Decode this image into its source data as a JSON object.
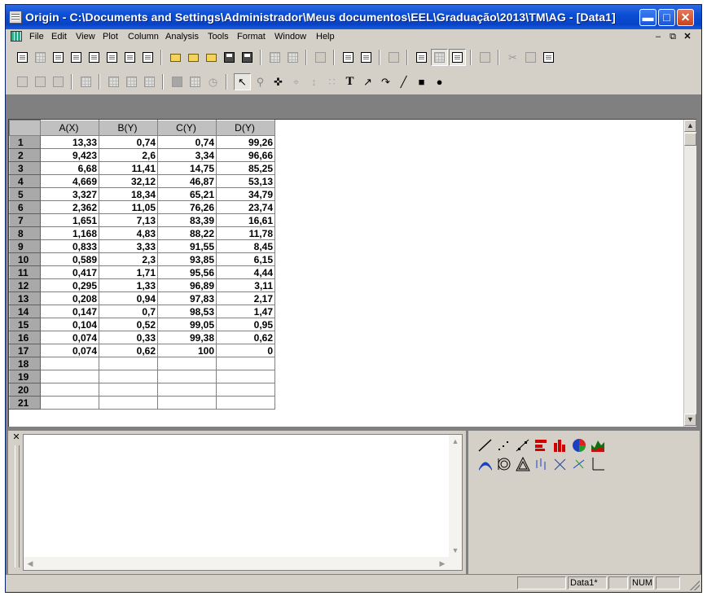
{
  "window": {
    "title": "Origin - C:\\Documents and Settings\\Administrador\\Meus documentos\\EEL\\Graduação\\2013\\TM\\AG - [Data1]",
    "caption_buttons": [
      "minimize-icon",
      "maximize-icon",
      "close-icon"
    ]
  },
  "menubar": {
    "items": [
      "File",
      "Edit",
      "View",
      "Plot",
      "Column",
      "Analysis",
      "Tools",
      "Format",
      "Window",
      "Help"
    ],
    "mdi_controls": [
      "minimize-icon",
      "restore-icon",
      "close-icon"
    ]
  },
  "toolbar_standard": {
    "icons": [
      "new-project-icon",
      "new-worksheet-icon",
      "new-excel-icon",
      "new-graph-icon",
      "new-matrix-icon",
      "new-function-icon",
      "new-layout-icon",
      "new-notes-icon",
      "open-icon",
      "open-template-icon",
      "open-excel-icon",
      "save-project-icon",
      "save-template-icon",
      "import-ascii-icon",
      "import-multiple-ascii-icon",
      "print-icon",
      "refresh-icon",
      "duplicate-icon",
      "project-explorer-icon",
      "results-log-icon",
      "script-window-icon",
      "code-builder-icon",
      "add-column-icon",
      "cut-icon",
      "copy-icon",
      "paste-icon"
    ]
  },
  "toolbar_tools": {
    "icons": [
      "zoom-in-icon",
      "zoom-out-icon",
      "whole-page-icon",
      "rescale-icon",
      "merge-icon",
      "layer-icon",
      "arrange-icon",
      "color-icon",
      "data-display-icon",
      "clock-icon",
      "pointer-icon",
      "zoom-icon",
      "screen-reader-icon",
      "data-reader-icon",
      "data-selector-icon",
      "draw-data-icon",
      "text-tool-icon",
      "arrow-tool-icon",
      "curved-arrow-icon",
      "line-tool-icon",
      "rectangle-tool-icon",
      "circle-tool-icon"
    ],
    "text_tool_label": "T"
  },
  "worksheet": {
    "name": "Data1",
    "columns": [
      "A(X)",
      "B(Y)",
      "C(Y)",
      "D(Y)"
    ],
    "rows": [
      [
        "1",
        "13,33",
        "0,74",
        "0,74",
        "99,26"
      ],
      [
        "2",
        "9,423",
        "2,6",
        "3,34",
        "96,66"
      ],
      [
        "3",
        "6,68",
        "11,41",
        "14,75",
        "85,25"
      ],
      [
        "4",
        "4,669",
        "32,12",
        "46,87",
        "53,13"
      ],
      [
        "5",
        "3,327",
        "18,34",
        "65,21",
        "34,79"
      ],
      [
        "6",
        "2,362",
        "11,05",
        "76,26",
        "23,74"
      ],
      [
        "7",
        "1,651",
        "7,13",
        "83,39",
        "16,61"
      ],
      [
        "8",
        "1,168",
        "4,83",
        "88,22",
        "11,78"
      ],
      [
        "9",
        "0,833",
        "3,33",
        "91,55",
        "8,45"
      ],
      [
        "10",
        "0,589",
        "2,3",
        "93,85",
        "6,15"
      ],
      [
        "11",
        "0,417",
        "1,71",
        "95,56",
        "4,44"
      ],
      [
        "12",
        "0,295",
        "1,33",
        "96,89",
        "3,11"
      ],
      [
        "13",
        "0,208",
        "0,94",
        "97,83",
        "2,17"
      ],
      [
        "14",
        "0,147",
        "0,7",
        "98,53",
        "1,47"
      ],
      [
        "15",
        "0,104",
        "0,52",
        "99,05",
        "0,95"
      ],
      [
        "16",
        "0,074",
        "0,33",
        "99,38",
        "0,62"
      ],
      [
        "17",
        "0,074",
        "0,62",
        "100",
        "0"
      ],
      [
        "18",
        "",
        "",
        "",
        ""
      ],
      [
        "19",
        "",
        "",
        "",
        ""
      ],
      [
        "20",
        "",
        "",
        "",
        ""
      ],
      [
        "21",
        "",
        "",
        "",
        ""
      ]
    ]
  },
  "palette_2d": {
    "icons": [
      "line-plot-icon",
      "scatter-plot-icon",
      "line-symbol-plot-icon",
      "horizontal-bar-icon",
      "column-plot-icon",
      "pie-chart-icon",
      "area-plot-icon",
      "polar-plot-icon",
      "ternary-icon",
      "triangle-plot-icon",
      "high-low-close-icon",
      "vector-xyam-icon",
      "vector-xyxy-icon",
      "template-icon"
    ]
  },
  "statusbar": {
    "window_name": "Data1*",
    "num_indicator": "NUM"
  },
  "colors": {
    "titlebar": "#0a4fd6",
    "face": "#d4d0c8",
    "workspace": "#808080",
    "row_header": "#a9a9a9"
  }
}
